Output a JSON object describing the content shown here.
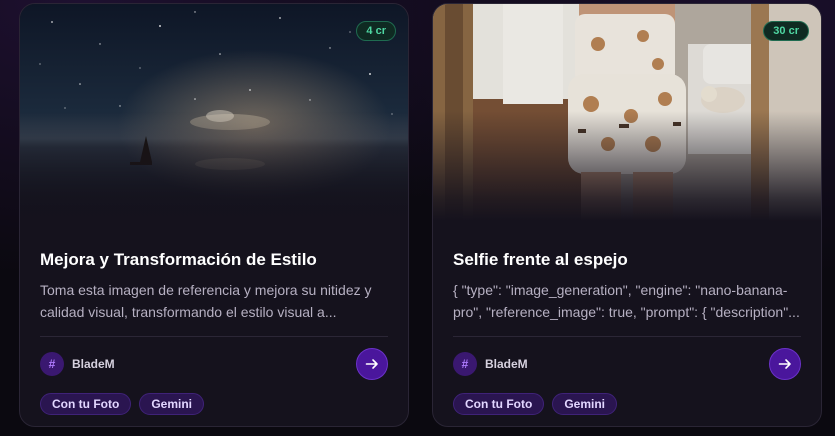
{
  "cards": [
    {
      "cost": "4 cr",
      "title": "Mejora y Transformación de Estilo",
      "description": "Toma esta imagen de referencia y mejora su nitidez y calidad visual, transformando el estilo visual a...",
      "author": "BladeM",
      "author_icon": "hash-icon",
      "tags": [
        "Con tu Foto",
        "Gemini"
      ],
      "thumbnail": "night-sky-sailboat-image"
    },
    {
      "cost": "30 cr",
      "title": "Selfie frente al espejo",
      "description": "{ \"type\": \"image_generation\", \"engine\": \"nano-banana-pro\", \"reference_image\": true, \"prompt\": { \"description\"...",
      "author": "BladeM",
      "author_icon": "hash-icon",
      "tags": [
        "Con tu Foto",
        "Gemini"
      ],
      "thumbnail": "mirror-selfie-image"
    }
  ],
  "colors": {
    "card_bg": "#15121d",
    "accent": "#4a169c",
    "badge_text": "#4fd6a2",
    "tag_bg": "#2a1550"
  }
}
